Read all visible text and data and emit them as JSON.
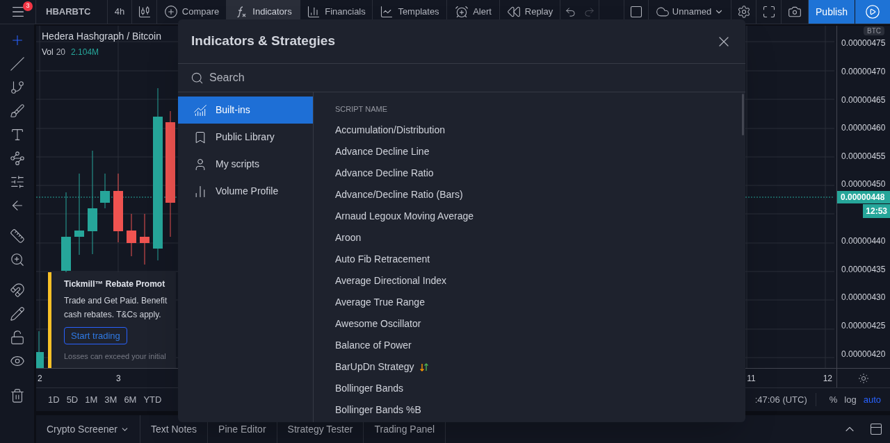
{
  "top_bar": {
    "menu_badge": "3",
    "symbol": "HBARBTC",
    "interval": "4h",
    "compare": "Compare",
    "indicators": {
      "label": "Indicators",
      "selected": true
    },
    "financials": "Financials",
    "templates": "Templates",
    "alert": "Alert",
    "replay": "Replay",
    "layout_name": "Unnamed",
    "publish": "Publish"
  },
  "left_toolbar": {
    "tools": [
      {
        "selected": true
      },
      {
        "selected": false
      },
      {
        "selected": false
      },
      {
        "selected": false
      },
      {
        "selected": false
      },
      {
        "selected": false
      },
      {
        "selected": false
      },
      {
        "selected": false
      },
      {
        "selected": false
      },
      {
        "selected": false
      },
      {
        "selected": false
      },
      {
        "selected": false
      },
      {
        "selected": false
      },
      {
        "selected": false
      },
      {
        "selected": false
      }
    ]
  },
  "chart": {
    "legend": {
      "title": "Hedera Hashgraph / Bitcoin",
      "vol_label": "Vol",
      "vol_length": "20",
      "vol_value": "2.104M"
    },
    "price_axis": {
      "currency": "BTC",
      "labels": [
        "0.00000475",
        "0.00000470",
        "0.00000465",
        "0.00000460",
        "0.00000455",
        "0.00000450",
        "0.00000440",
        "0.00000435",
        "0.00000430",
        "0.00000425",
        "0.00000420"
      ],
      "last_price": "0.00000448",
      "countdown": "12:53"
    },
    "time_axis": {
      "labels": [
        "2",
        "3",
        "11",
        "12"
      ]
    },
    "ad": {
      "title": "Tickmill™ Rebate Promot",
      "lines": [
        "Trade and Get Paid. Benefit",
        "cash rebates. T&Cs apply."
      ],
      "button": "Start trading",
      "disclaimer": "Losses can exceed your initial"
    }
  },
  "range_bar": {
    "ranges": [
      "1D",
      "5D",
      "1M",
      "3M",
      "6M",
      "YTD"
    ],
    "time": ":47:06 (UTC)",
    "toggles": [
      {
        "label": "%",
        "selected": false
      },
      {
        "label": "log",
        "selected": false
      },
      {
        "label": "auto",
        "selected": true
      }
    ]
  },
  "bottom_tabs": [
    {
      "label": "Crypto Screener",
      "kind": "dropdown"
    },
    {
      "label": "Text Notes",
      "kind": "tab"
    },
    {
      "label": "Pine Editor",
      "kind": "tab"
    },
    {
      "label": "Strategy Tester",
      "kind": "tab"
    },
    {
      "label": "Trading Panel",
      "kind": "tab"
    }
  ],
  "dialog": {
    "title": "Indicators & Strategies",
    "search_placeholder": "Search",
    "categories": [
      {
        "label": "Built-ins",
        "selected": true
      },
      {
        "label": "Public Library",
        "selected": false
      },
      {
        "label": "My scripts",
        "selected": false
      },
      {
        "label": "Volume Profile",
        "selected": false
      }
    ],
    "list_header": "SCRIPT NAME",
    "scripts": [
      {
        "name": "Accumulation/Distribution",
        "kind": "indicator"
      },
      {
        "name": "Advance Decline Line",
        "kind": "indicator"
      },
      {
        "name": "Advance Decline Ratio",
        "kind": "indicator"
      },
      {
        "name": "Advance/Decline Ratio (Bars)",
        "kind": "indicator"
      },
      {
        "name": "Arnaud Legoux Moving Average",
        "kind": "indicator"
      },
      {
        "name": "Aroon",
        "kind": "indicator"
      },
      {
        "name": "Auto Fib Retracement",
        "kind": "indicator"
      },
      {
        "name": "Average Directional Index",
        "kind": "indicator"
      },
      {
        "name": "Average True Range",
        "kind": "indicator"
      },
      {
        "name": "Awesome Oscillator",
        "kind": "indicator"
      },
      {
        "name": "Balance of Power",
        "kind": "indicator"
      },
      {
        "name": "BarUpDn Strategy",
        "kind": "strategy"
      },
      {
        "name": "Bollinger Bands",
        "kind": "indicator"
      },
      {
        "name": "Bollinger Bands %B",
        "kind": "indicator"
      }
    ]
  }
}
